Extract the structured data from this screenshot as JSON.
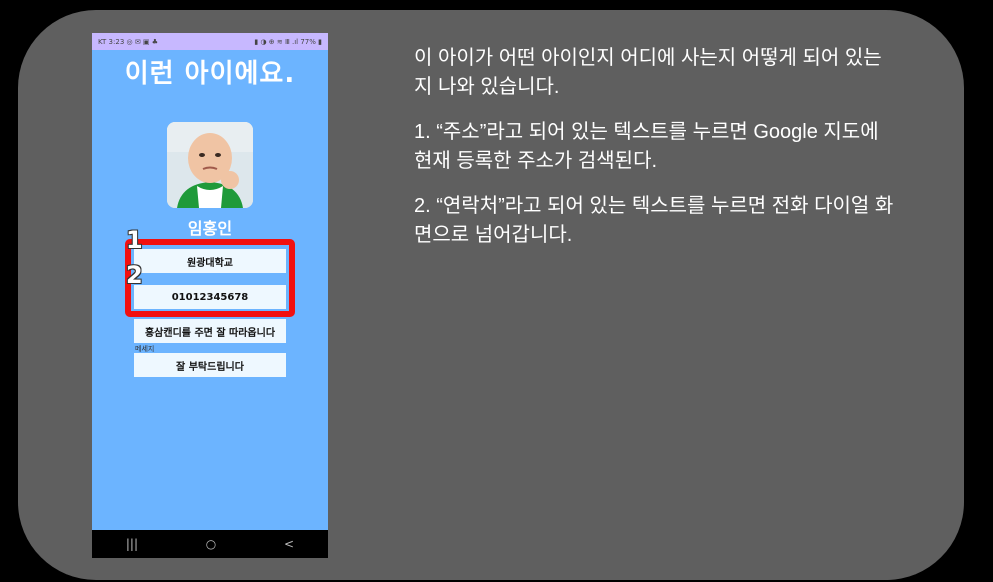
{
  "phone": {
    "status_left": "KT 3:23 ◎ ✉ ▣ ♣",
    "status_right": "▮ ◑ ⊕ ≋ Ⅲ .ıl 77% ▮",
    "app_title": "이런 아이에요.",
    "name": "임홍인",
    "address_field": "원광대학교",
    "contact_field": "01012345678",
    "extra_field": "홍삼캔디를 주면 잘 따라옵니다",
    "message_label": "메세지",
    "message_field": "잘 부탁드립니다",
    "marker_1": "1",
    "marker_2": "2",
    "nav": {
      "recent": "|||",
      "home": "○",
      "back": "<"
    }
  },
  "description": {
    "paragraph_1": "이  아이가 어떤 아이인지 어디에 사는지 어떻게 되어 있는지 나와 있습니다.",
    "paragraph_2": "1.  “주소”라고 되어 있는 텍스트를 누르면 Google 지도에 현재 등록한 주소가 검색된다.",
    "paragraph_3": "2.  “연락처”라고 되어 있는 텍스트를 누르면 전화 다이얼 화면으로 넘어갑니다."
  },
  "colors": {
    "slide_bg": "#5f5f5f",
    "phone_bg": "#6cb4ff",
    "status_bg": "#c7b8ff",
    "highlight": "#f21010"
  },
  "icons": [
    "photo-avatar",
    "recent-apps-icon",
    "home-icon",
    "back-icon"
  ]
}
